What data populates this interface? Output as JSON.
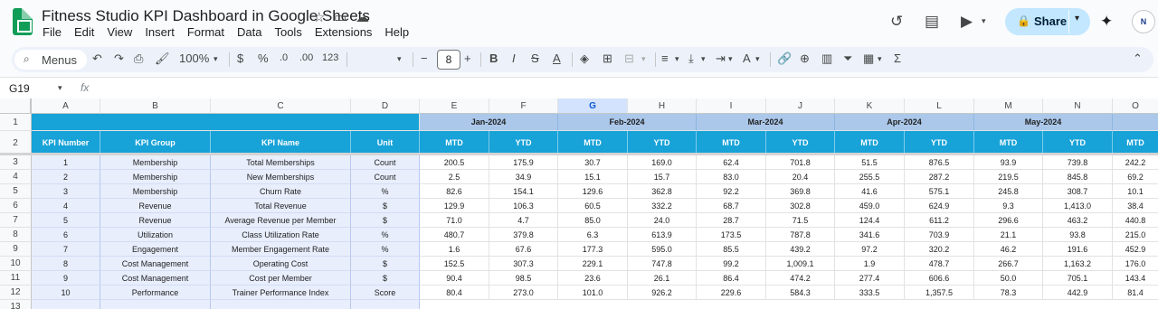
{
  "app": {
    "title": "Fitness Studio KPI Dashboard in Google Sheets",
    "menus": [
      "File",
      "Edit",
      "View",
      "Insert",
      "Format",
      "Data",
      "Tools",
      "Extensions",
      "Help"
    ],
    "share_label": "Share",
    "avatar_text": "N"
  },
  "toolbar": {
    "menus_label": "Menus",
    "zoom": "100%",
    "currency": "$",
    "percent": "%",
    "dec_decrease": ".0",
    "dec_increase": ".00",
    "number_format": "123",
    "font_size": "8",
    "minus": "−",
    "plus": "+"
  },
  "formula_bar": {
    "name_box": "G19",
    "fx": "fx",
    "formula": ""
  },
  "sheet": {
    "columns": [
      "A",
      "B",
      "C",
      "D",
      "E",
      "F",
      "G",
      "H",
      "I",
      "J",
      "K",
      "L",
      "M",
      "N",
      "O"
    ],
    "selected_column": "G",
    "row_numbers": [
      "1",
      "2",
      "3",
      "4",
      "5",
      "6",
      "7",
      "8",
      "9",
      "10",
      "11",
      "12",
      "13"
    ],
    "months": [
      "Jan-2024",
      "Feb-2024",
      "Mar-2024",
      "Apr-2024",
      "May-2024"
    ],
    "headers": [
      "KPI Number",
      "KPI Group",
      "KPI Name",
      "Unit"
    ],
    "sub_headers": [
      "MTD",
      "YTD",
      "MTD",
      "YTD",
      "MTD",
      "YTD",
      "MTD",
      "YTD",
      "MTD",
      "YTD",
      "MTD"
    ],
    "rows": [
      {
        "num": "1",
        "group": "Membership",
        "name": "Total Memberships",
        "unit": "Count",
        "vals": [
          "200.5",
          "175.9",
          "30.7",
          "169.0",
          "62.4",
          "701.8",
          "51.5",
          "876.5",
          "93.9",
          "739.8",
          "242.2"
        ]
      },
      {
        "num": "2",
        "group": "Membership",
        "name": "New Memberships",
        "unit": "Count",
        "vals": [
          "2.5",
          "34.9",
          "15.1",
          "15.7",
          "83.0",
          "20.4",
          "255.5",
          "287.2",
          "219.5",
          "845.8",
          "69.2"
        ]
      },
      {
        "num": "3",
        "group": "Membership",
        "name": "Churn Rate",
        "unit": "%",
        "vals": [
          "82.6",
          "154.1",
          "129.6",
          "362.8",
          "92.2",
          "369.8",
          "41.6",
          "575.1",
          "245.8",
          "308.7",
          "10.1"
        ]
      },
      {
        "num": "4",
        "group": "Revenue",
        "name": "Total Revenue",
        "unit": "$",
        "vals": [
          "129.9",
          "106.3",
          "60.5",
          "332.2",
          "68.7",
          "302.8",
          "459.0",
          "624.9",
          "9.3",
          "1,413.0",
          "38.4"
        ]
      },
      {
        "num": "5",
        "group": "Revenue",
        "name": "Average Revenue per Member",
        "unit": "$",
        "vals": [
          "71.0",
          "4.7",
          "85.0",
          "24.0",
          "28.7",
          "71.5",
          "124.4",
          "611.2",
          "296.6",
          "463.2",
          "440.8"
        ]
      },
      {
        "num": "6",
        "group": "Utilization",
        "name": "Class Utilization Rate",
        "unit": "%",
        "vals": [
          "480.7",
          "379.8",
          "6.3",
          "613.9",
          "173.5",
          "787.8",
          "341.6",
          "703.9",
          "21.1",
          "93.8",
          "215.0"
        ]
      },
      {
        "num": "7",
        "group": "Engagement",
        "name": "Member Engagement Rate",
        "unit": "%",
        "vals": [
          "1.6",
          "67.6",
          "177.3",
          "595.0",
          "85.5",
          "439.2",
          "97.2",
          "320.2",
          "46.2",
          "191.6",
          "452.9"
        ]
      },
      {
        "num": "8",
        "group": "Cost Management",
        "name": "Operating Cost",
        "unit": "$",
        "vals": [
          "152.5",
          "307.3",
          "229.1",
          "747.8",
          "99.2",
          "1,009.1",
          "1.9",
          "478.7",
          "266.7",
          "1,163.2",
          "176.0"
        ]
      },
      {
        "num": "9",
        "group": "Cost Management",
        "name": "Cost per Member",
        "unit": "$",
        "vals": [
          "90.4",
          "98.5",
          "23.6",
          "26.1",
          "86.4",
          "474.2",
          "277.4",
          "606.6",
          "50.0",
          "705.1",
          "143.4"
        ]
      },
      {
        "num": "10",
        "group": "Performance",
        "name": "Trainer Performance Index",
        "unit": "Score",
        "vals": [
          "80.4",
          "273.0",
          "101.0",
          "926.2",
          "229.6",
          "584.3",
          "333.5",
          "1,357.5",
          "78.3",
          "442.9",
          "81.4"
        ]
      }
    ]
  }
}
